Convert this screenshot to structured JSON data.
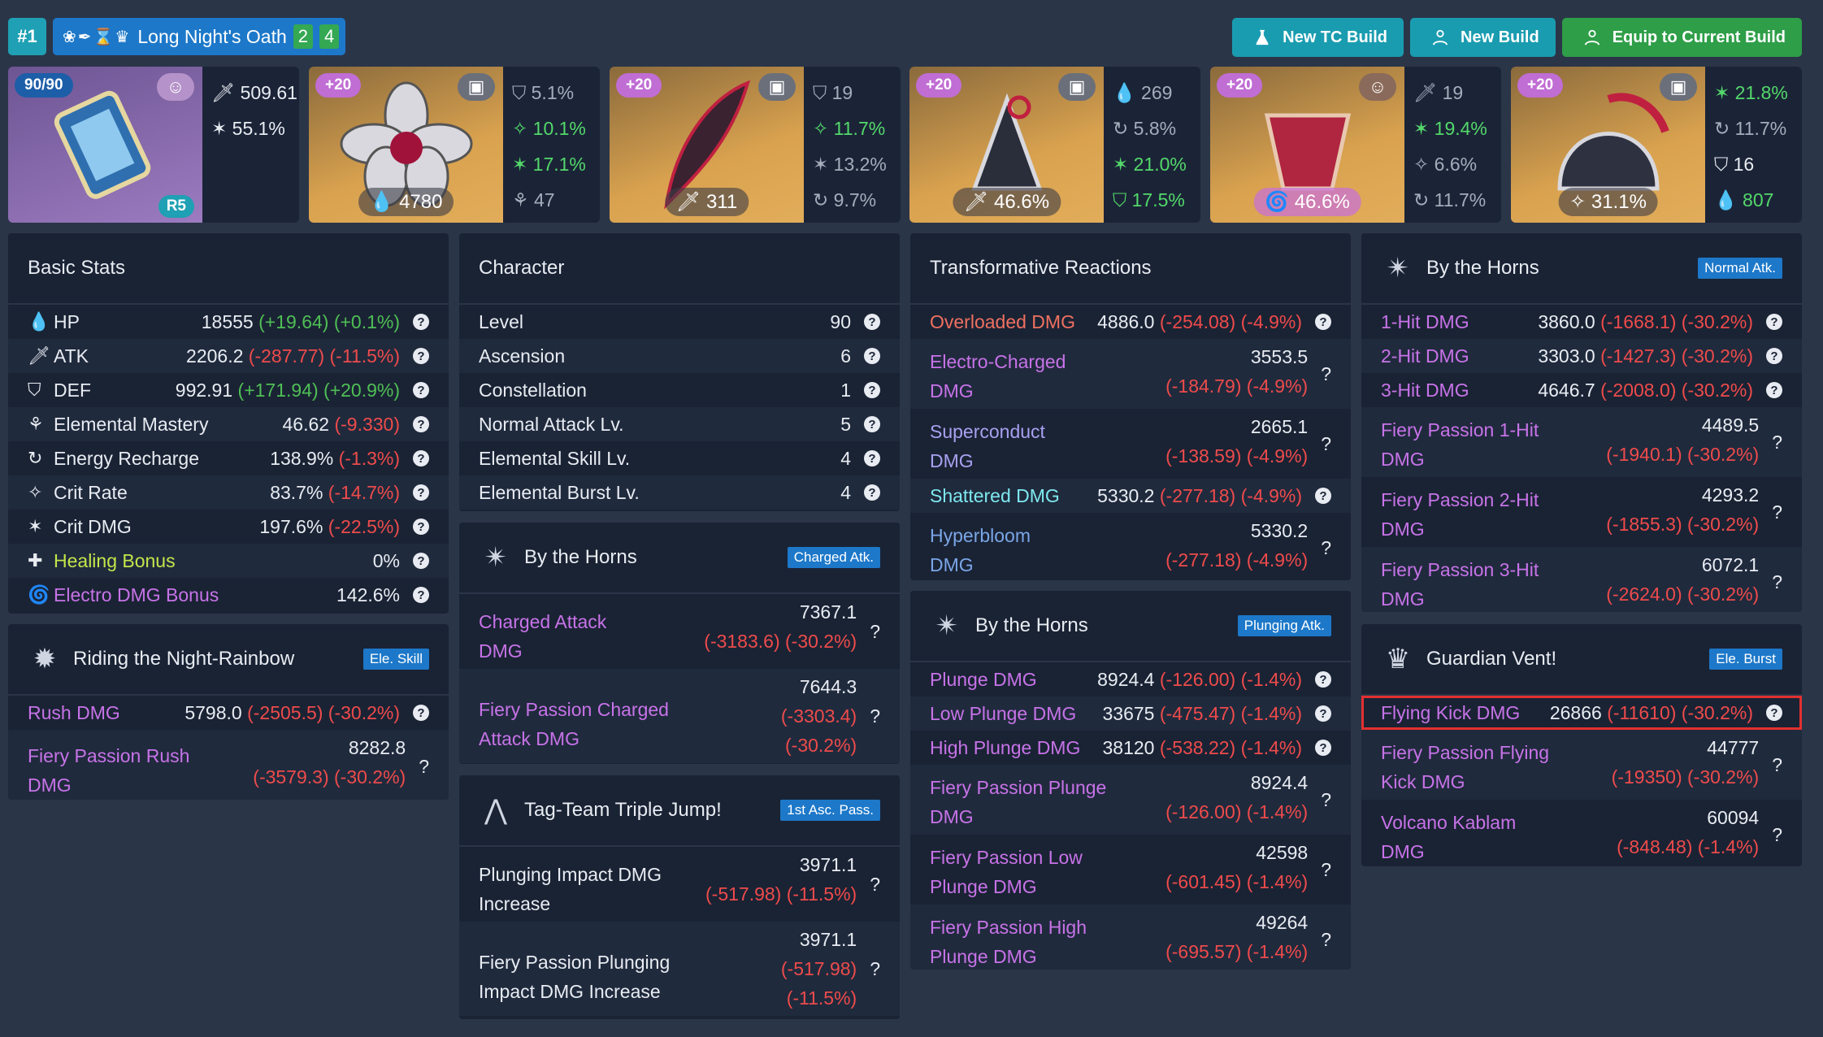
{
  "header": {
    "rank": "#1",
    "set_icons": "❀✒⌛♛",
    "set_name": "Long Night's Oath",
    "set_count_a": "2",
    "set_count_b": "4",
    "buttons": {
      "new_tc": "New TC Build",
      "new_build": "New Build",
      "equip": "Equip to Current Build"
    }
  },
  "weapon": {
    "level": "90/90",
    "refine": "R5",
    "atk": "509.61",
    "crit_rate": "55.1%"
  },
  "artifacts": [
    {
      "level": "+20",
      "main": "4780",
      "subs": [
        "5.1%",
        "10.1%",
        "17.1%",
        "47"
      ]
    },
    {
      "level": "+20",
      "main": "311",
      "subs": [
        "19",
        "11.7%",
        "13.2%",
        "9.7%"
      ]
    },
    {
      "level": "+20",
      "main": "46.6%",
      "subs": [
        "269",
        "5.8%",
        "21.0%",
        "17.5%"
      ]
    },
    {
      "level": "+20",
      "main": "46.6%",
      "subs": [
        "19",
        "19.4%",
        "6.6%",
        "11.7%"
      ]
    },
    {
      "level": "+20",
      "main": "31.1%",
      "subs": [
        "21.8%",
        "11.7%",
        "16",
        "807"
      ]
    }
  ],
  "basic": {
    "title": "Basic Stats",
    "rows": [
      {
        "label": "HP",
        "value": "18555",
        "delta": "(+19.64) (+0.1%)"
      },
      {
        "label": "ATK",
        "value": "2206.2",
        "delta": "(-287.77) (-11.5%)"
      },
      {
        "label": "DEF",
        "value": "992.91",
        "delta": "(+171.94) (+20.9%)"
      },
      {
        "label": "Elemental Mastery",
        "value": "46.62",
        "delta": "(-9.330)"
      },
      {
        "label": "Energy Recharge",
        "value": "138.9%",
        "delta": "(-1.3%)"
      },
      {
        "label": "Crit Rate",
        "value": "83.7%",
        "delta": "(-14.7%)"
      },
      {
        "label": "Crit DMG",
        "value": "197.6%",
        "delta": "(-22.5%)"
      },
      {
        "label": "Healing Bonus",
        "value": "0%",
        "delta": ""
      },
      {
        "label": "Electro DMG Bonus",
        "value": "142.6%",
        "delta": ""
      }
    ]
  },
  "riding": {
    "title": "Riding the Night-Rainbow",
    "badge": "Ele. Skill",
    "r1": {
      "label": "Rush DMG",
      "value": "5798.0",
      "delta": "(-2505.5) (-30.2%)"
    },
    "r2": {
      "label1": "Fiery Passion Rush",
      "label2": "DMG",
      "value": "8282.8",
      "delta": "(-3579.3) (-30.2%)"
    }
  },
  "character": {
    "title": "Character",
    "rows": [
      {
        "label": "Level",
        "value": "90"
      },
      {
        "label": "Ascension",
        "value": "6"
      },
      {
        "label": "Constellation",
        "value": "1"
      },
      {
        "label": "Normal Attack Lv.",
        "value": "5"
      },
      {
        "label": "Elemental Skill Lv.",
        "value": "4"
      },
      {
        "label": "Elemental Burst Lv.",
        "value": "4"
      }
    ]
  },
  "horns_charged": {
    "title": "By the Horns",
    "badge": "Charged Atk.",
    "r1": {
      "l1": "Charged Attack",
      "l2": "DMG",
      "value": "7367.1",
      "delta": "(-3183.6) (-30.2%)"
    },
    "r2": {
      "l1": "Fiery Passion Charged",
      "l2": "Attack DMG",
      "value": "7644.3",
      "d1": "(-3303.4)",
      "d2": "(-30.2%)"
    }
  },
  "tagteam": {
    "title": "Tag-Team Triple Jump!",
    "badge": "1st Asc. Pass.",
    "r1": {
      "l1": "Plunging Impact DMG",
      "l2": "Increase",
      "value": "3971.1",
      "delta": "(-517.98) (-11.5%)"
    },
    "r2": {
      "l1": "Fiery Passion Plunging",
      "l2": "Impact DMG Increase",
      "value": "3971.1",
      "d1": "(-517.98)",
      "d2": "(-11.5%)"
    }
  },
  "transform": {
    "title": "Transformative Reactions",
    "overloaded": {
      "label": "Overloaded DMG",
      "value": "4886.0",
      "delta": "(-254.08) (-4.9%)"
    },
    "electro": {
      "l1": "Electro-Charged",
      "l2": "DMG",
      "value": "3553.5",
      "delta": "(-184.79) (-4.9%)"
    },
    "supercond": {
      "l1": "Superconduct",
      "l2": "DMG",
      "value": "2665.1",
      "delta": "(-138.59) (-4.9%)"
    },
    "shattered": {
      "label": "Shattered DMG",
      "value": "5330.2",
      "delta": "(-277.18) (-4.9%)"
    },
    "hyper": {
      "l1": "Hyperbloom",
      "l2": "DMG",
      "value": "5330.2",
      "delta": "(-277.18) (-4.9%)"
    }
  },
  "horns_plunge": {
    "title": "By the Horns",
    "badge": "Plunging Atk.",
    "plunge": {
      "label": "Plunge DMG",
      "value": "8924.4",
      "delta": "(-126.00) (-1.4%)"
    },
    "low": {
      "label": "Low Plunge DMG",
      "value": "33675",
      "delta": "(-475.47) (-1.4%)"
    },
    "high": {
      "label": "High Plunge DMG",
      "value": "38120",
      "delta": "(-538.22) (-1.4%)"
    },
    "fp": {
      "l1": "Fiery Passion Plunge",
      "l2": "DMG",
      "value": "8924.4",
      "delta": "(-126.00) (-1.4%)"
    },
    "fpl": {
      "l1": "Fiery Passion Low",
      "l2": "Plunge DMG",
      "value": "42598",
      "delta": "(-601.45) (-1.4%)"
    },
    "fph": {
      "l1": "Fiery Passion High",
      "l2": "Plunge DMG",
      "value": "49264",
      "delta": "(-695.57) (-1.4%)"
    }
  },
  "horns_normal": {
    "title": "By the Horns",
    "badge": "Normal Atk.",
    "h1": {
      "label": "1-Hit DMG",
      "value": "3860.0",
      "delta": "(-1668.1) (-30.2%)"
    },
    "h2": {
      "label": "2-Hit DMG",
      "value": "3303.0",
      "delta": "(-1427.3) (-30.2%)"
    },
    "h3": {
      "label": "3-Hit DMG",
      "value": "4646.7",
      "delta": "(-2008.0) (-30.2%)"
    },
    "f1": {
      "l1": "Fiery Passion 1-Hit",
      "l2": "DMG",
      "value": "4489.5",
      "delta": "(-1940.1) (-30.2%)"
    },
    "f2": {
      "l1": "Fiery Passion 2-Hit",
      "l2": "DMG",
      "value": "4293.2",
      "delta": "(-1855.3) (-30.2%)"
    },
    "f3": {
      "l1": "Fiery Passion 3-Hit",
      "l2": "DMG",
      "value": "6072.1",
      "delta": "(-2624.0) (-30.2%)"
    }
  },
  "guardian": {
    "title": "Guardian Vent!",
    "badge": "Ele. Burst",
    "kick": {
      "label": "Flying Kick DMG",
      "value": "26866",
      "delta": "(-11610) (-30.2%)"
    },
    "fkick": {
      "l1": "Fiery Passion Flying",
      "l2": "Kick DMG",
      "value": "44777",
      "delta": "(-19350) (-30.2%)"
    },
    "volcano": {
      "l1": "Volcano Kablam",
      "l2": "DMG",
      "value": "60094",
      "delta": "(-848.48) (-1.4%)"
    }
  },
  "help_glyph": "?"
}
